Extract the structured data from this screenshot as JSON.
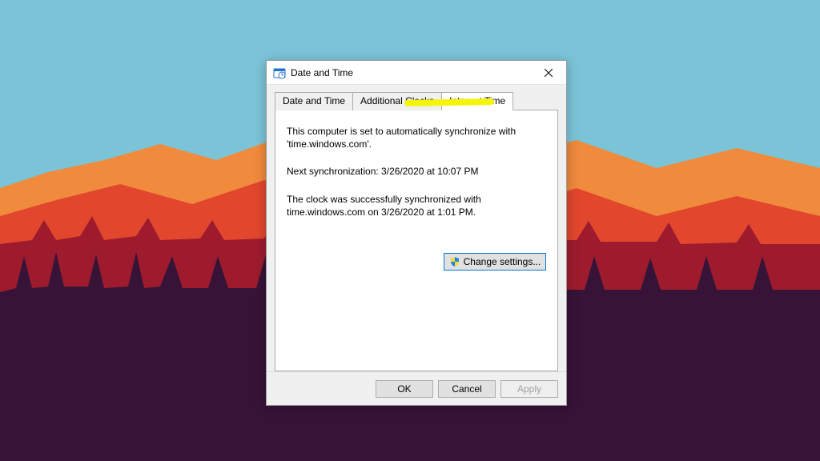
{
  "dialog": {
    "title": "Date and Time",
    "tabs": [
      {
        "label": "Date and Time"
      },
      {
        "label": "Additional Clocks"
      },
      {
        "label": "Internet Time"
      }
    ],
    "panel": {
      "sync_status": "This computer is set to automatically synchronize with 'time.windows.com'.",
      "next_sync": "Next synchronization: 3/26/2020 at 10:07 PM",
      "last_sync": "The clock was successfully synchronized with time.windows.com on 3/26/2020 at 1:01 PM.",
      "change_settings_label": "Change settings..."
    },
    "buttons": {
      "ok": "OK",
      "cancel": "Cancel",
      "apply": "Apply"
    }
  }
}
